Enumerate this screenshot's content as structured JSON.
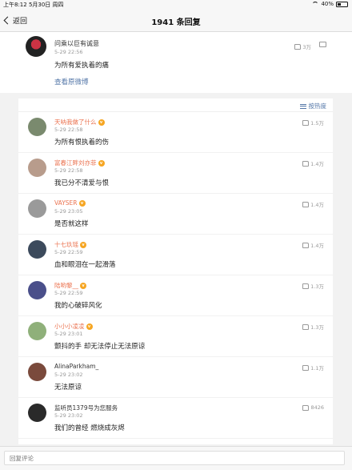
{
  "status": {
    "left": "上午8:12  5月30日 周四",
    "battery": "40%",
    "battery_level": 0.4
  },
  "nav": {
    "back_label": "返回",
    "title": "1941 条回复"
  },
  "original": {
    "name": "问乘以巨有诚意",
    "time": "5-29 22:56",
    "text": "为所有爱执着的痛",
    "likes": "3万",
    "view_link": "查看原微博"
  },
  "sort_label": "按热度",
  "comments": [
    {
      "name": "天呐我做了什么",
      "vip": true,
      "name_color": "#eb7350",
      "time": "5-29 22:58",
      "text": "为所有恨执着的伤",
      "likes": "1.5万",
      "avatar_color": "#7a8a6e"
    },
    {
      "name": "富春江畔刘亦菲",
      "vip": true,
      "name_color": "#eb7350",
      "time": "5-29 22:58",
      "text": "我已分不清爱与恨",
      "likes": "1.4万",
      "avatar_color": "#b89c8c"
    },
    {
      "name": "VAYSER",
      "vip": true,
      "name_color": "#eb7350",
      "time": "5-29 23:05",
      "text": "是否就这样",
      "likes": "1.4万",
      "avatar_color": "#9a9a9a"
    },
    {
      "name": "十七玖瑶",
      "vip": true,
      "name_color": "#eb7350",
      "time": "5-29 22:59",
      "text": "血和眼泪在一起滑落",
      "likes": "1.4万",
      "avatar_color": "#3c4a5c"
    },
    {
      "name": "陆哟黎__",
      "vip": true,
      "name_color": "#eb7350",
      "time": "5-29 22:59",
      "text": "我的心破碎风化",
      "likes": "1.3万",
      "avatar_color": "#4a4f8a"
    },
    {
      "name": "小小小凌凌",
      "vip": true,
      "name_color": "#eb7350",
      "time": "5-29 23:01",
      "text": "颤抖的手 却无法停止无法原谅",
      "likes": "1.3万",
      "avatar_color": "#8fb07a"
    },
    {
      "name": "AlinaParkham_",
      "vip": false,
      "name_color": "#333333",
      "time": "5-29 23:02",
      "text": "无法原谅",
      "likes": "1.1万",
      "avatar_color": "#7a4a3c"
    },
    {
      "name": "监听员1379号为您服务",
      "vip": false,
      "name_color": "#333333",
      "time": "5-29 23:02",
      "text": "我们的曾经 燃烧成灰烬",
      "likes": "8426",
      "avatar_color": "#2a2a2a"
    }
  ],
  "reply_placeholder": "回复评论"
}
